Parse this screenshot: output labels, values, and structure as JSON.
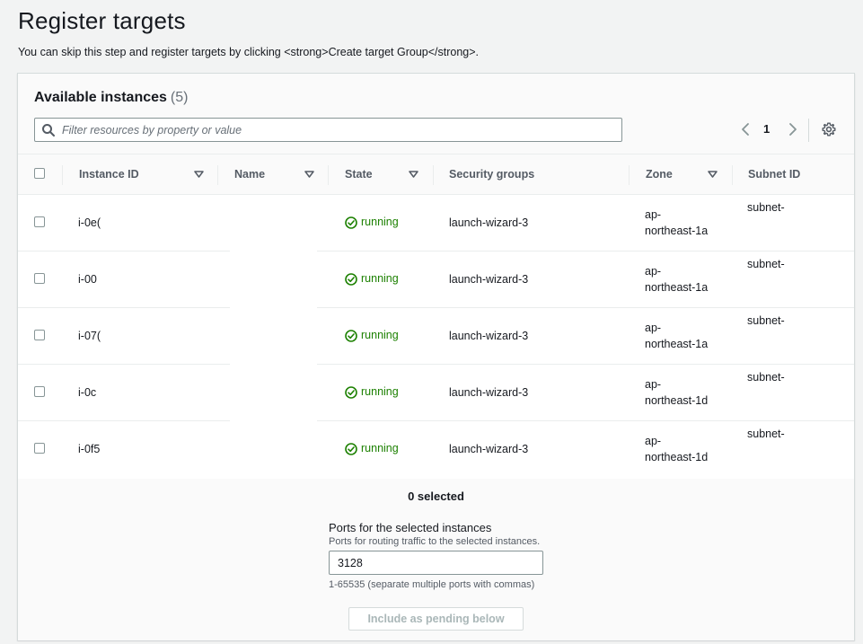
{
  "page": {
    "title": "Register targets",
    "description": "You can skip this step and register targets by clicking <strong>Create target Group</strong>."
  },
  "panel": {
    "title": "Available instances",
    "count": "(5)",
    "filter_placeholder": "Filter resources by property or value",
    "page_number": "1"
  },
  "table": {
    "columns": {
      "instance_id": "Instance ID",
      "name": "Name",
      "state": "State",
      "security_groups": "Security groups",
      "zone": "Zone",
      "subnet_id": "Subnet ID"
    },
    "rows": [
      {
        "instance_id": "i-0e(",
        "state": "running",
        "security_group": "launch-wizard-3",
        "zone_line1": "ap-",
        "zone_line2": "northeast-1a",
        "subnet": "subnet-"
      },
      {
        "instance_id": "i-00",
        "state": "running",
        "security_group": "launch-wizard-3",
        "zone_line1": "ap-",
        "zone_line2": "northeast-1a",
        "subnet": "subnet-"
      },
      {
        "instance_id": "i-07(",
        "state": "running",
        "security_group": "launch-wizard-3",
        "zone_line1": "ap-",
        "zone_line2": "northeast-1a",
        "subnet": "subnet-"
      },
      {
        "instance_id": "i-0c",
        "state": "running",
        "security_group": "launch-wizard-3",
        "zone_line1": "ap-",
        "zone_line2": "northeast-1d",
        "subnet": "subnet-"
      },
      {
        "instance_id": "i-0f5",
        "state": "running",
        "security_group": "launch-wizard-3",
        "zone_line1": "ap-",
        "zone_line2": "northeast-1d",
        "subnet": "subnet-"
      }
    ]
  },
  "footer": {
    "selected_count": "0 selected",
    "ports_label": "Ports for the selected instances",
    "ports_description": "Ports for routing traffic to the selected instances.",
    "ports_value": "3128",
    "ports_hint": "1-65535 (separate multiple ports with commas)",
    "pending_button": "Include as pending below"
  },
  "colors": {
    "running": "#1d8102",
    "header_bg": "#fafafa",
    "border": "#eaeded"
  },
  "icons": {
    "filter": "search-icon",
    "pager_prev": "chevron-left-icon",
    "pager_next": "chevron-right-icon",
    "settings": "gear-icon",
    "sort": "caret-down-icon",
    "status": "check-circle-icon"
  }
}
